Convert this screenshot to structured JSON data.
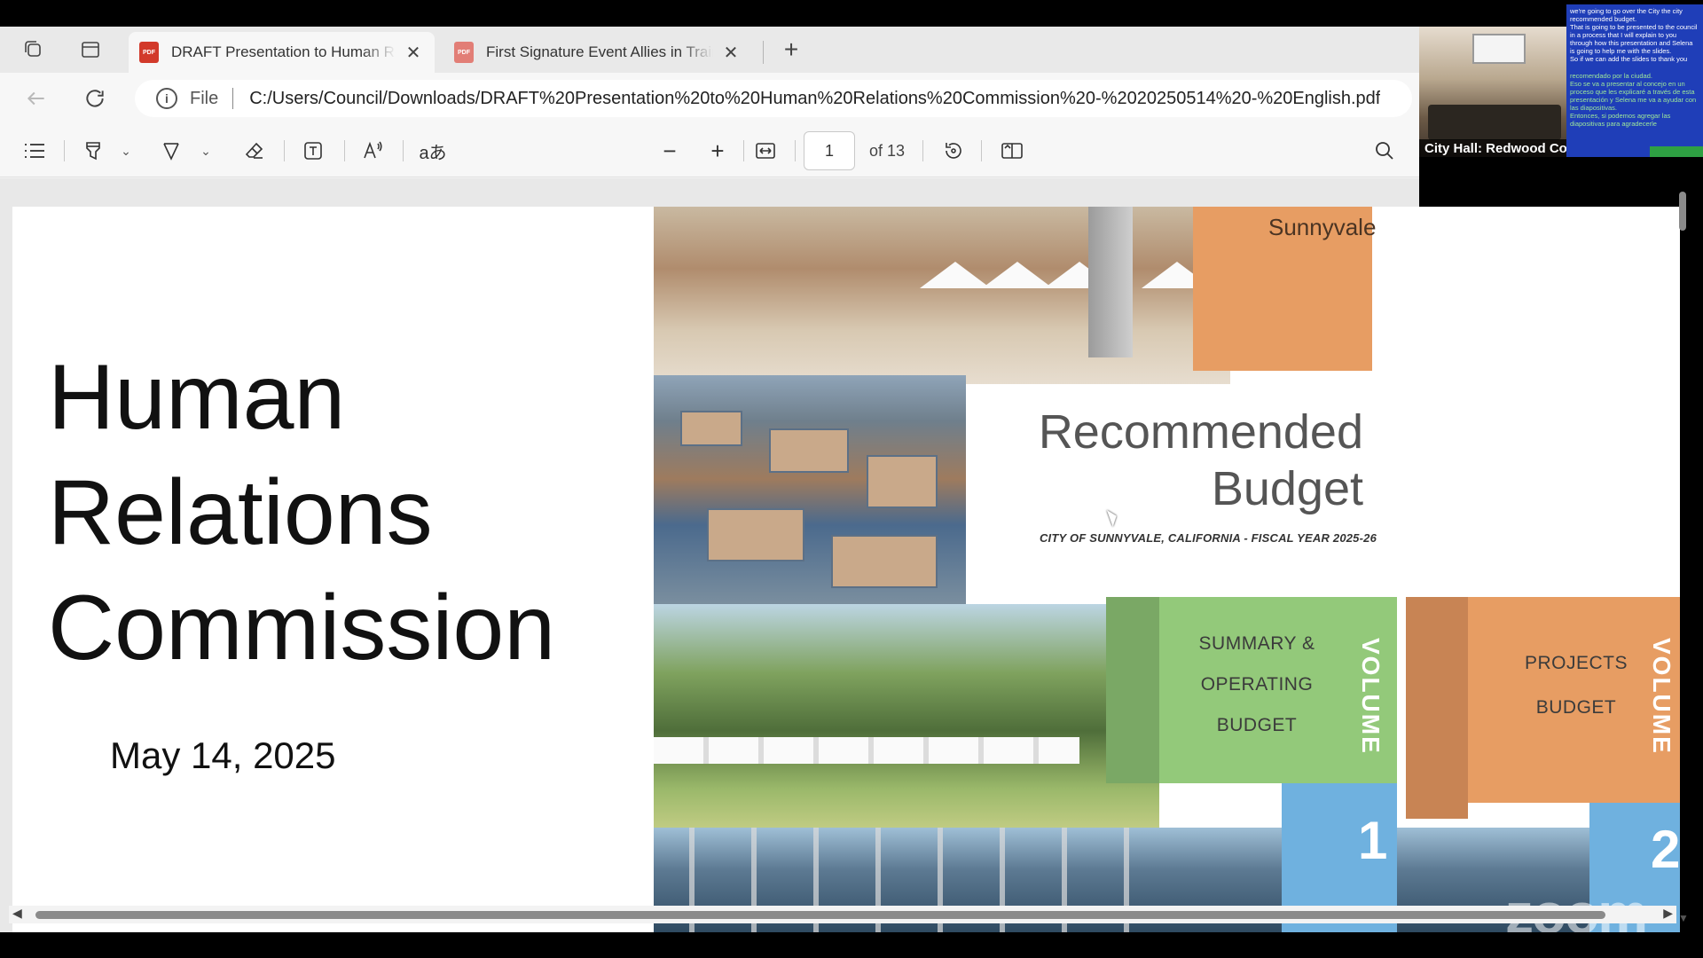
{
  "tabs": [
    {
      "title": "DRAFT Presentation to Human Relations Commission",
      "active": true
    },
    {
      "title": "First Signature Event Allies in Training",
      "active": false
    }
  ],
  "address": {
    "file_label": "File",
    "url": "C:/Users/Council/Downloads/DRAFT%20Presentation%20to%20Human%20Relations%20Commission%20-%2020250514%20-%20English.pdf"
  },
  "pdf_toolbar": {
    "current_page": "1",
    "page_of": "of 13"
  },
  "slide": {
    "title_lines": [
      "Human",
      "Relations",
      "Commission"
    ],
    "date": "May 14, 2025",
    "brand": "Sunnyvale",
    "cover_title_line1": "Recommended",
    "cover_title_line2": "Budget",
    "cover_subtitle": "CITY OF SUNNYVALE, CALIFORNIA - FISCAL YEAR 2025-26",
    "volume1_lines": [
      "SUMMARY &",
      "OPERATING",
      "BUDGET"
    ],
    "volume1_word": "VOLUME",
    "volume1_number": "1",
    "volume2_lines": [
      "PROJECTS",
      "BUDGET"
    ],
    "volume2_word": "VOLUME",
    "volume2_number": "2",
    "watermark": "zoom"
  },
  "video": {
    "label": "City Hall: Redwood Conference ..."
  },
  "captions": {
    "lines": [
      "we're going to go over the City the city",
      "recommended budget.",
      "That is going to be presented to the council",
      "in a process that I will explain to you",
      "through how this presentation and Selena",
      "is going to help me with the slides.",
      "So if we can add the slides to thank you"
    ],
    "translation_lines": [
      "recomendado por la ciudad.",
      "Eso se va a presentar al concejo en un",
      "proceso que les explicaré a través de esta",
      "presentación y Selena me va a ayudar con",
      "las diapositivas.",
      "Entonces, si podemos agregar las",
      "diapositivas para agradecerle"
    ]
  },
  "colors": {
    "orange": "#e79d63",
    "green": "#93c97a",
    "blue": "#6fb1df",
    "caption_bg": "#1f3eb8"
  }
}
